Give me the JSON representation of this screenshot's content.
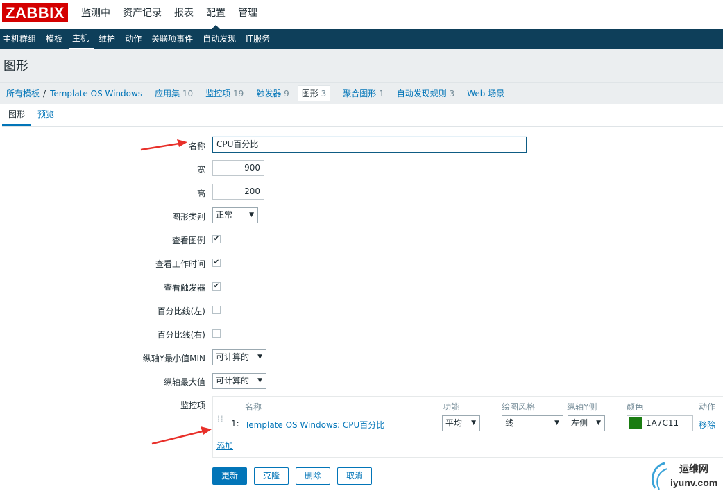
{
  "brand": "ZABBIX",
  "top_menu": [
    "监测中",
    "资产记录",
    "报表",
    "配置",
    "管理"
  ],
  "sub_menu": [
    "主机群组",
    "模板",
    "主机",
    "维护",
    "动作",
    "关联项事件",
    "自动发现",
    "IT服务"
  ],
  "page_title": "图形",
  "breadcrumb": {
    "all_templates": "所有模板",
    "separator": "/",
    "template": "Template OS Windows",
    "apps": {
      "label": "应用集",
      "count": "10"
    },
    "items": {
      "label": "监控项",
      "count": "19"
    },
    "triggers": {
      "label": "触发器",
      "count": "9"
    },
    "graphs": {
      "label": "图形",
      "count": "3"
    },
    "screens": {
      "label": "聚合图形",
      "count": "1"
    },
    "discovery": {
      "label": "自动发现规则",
      "count": "3"
    },
    "web": {
      "label": "Web 场景"
    }
  },
  "tabs": [
    "图形",
    "预览"
  ],
  "form": {
    "name_label": "名称",
    "name_value": "CPU百分比",
    "width_label": "宽",
    "width_value": "900",
    "height_label": "高",
    "height_value": "200",
    "graph_type_label": "图形类别",
    "graph_type_value": "正常",
    "show_legend_label": "查看图例",
    "show_legend": true,
    "show_working_time_label": "查看工作时间",
    "show_working_time": true,
    "show_triggers_label": "查看触发器",
    "show_triggers": true,
    "percentile_left_label": "百分比线(左)",
    "percentile_left": false,
    "percentile_right_label": "百分比线(右)",
    "percentile_right": false,
    "ymin_label": "纵轴Y最小值MIN",
    "ymin_value": "可计算的",
    "ymax_label": "纵轴最大值",
    "ymax_value": "可计算的",
    "items_label": "监控项"
  },
  "items_table": {
    "headers": {
      "name": "名称",
      "function": "功能",
      "draw_style": "绘图风格",
      "y_axis": "纵轴Y侧",
      "color": "颜色",
      "action": "动作"
    },
    "rows": [
      {
        "index": "1:",
        "name": "Template OS Windows: CPU百分比",
        "function": "平均",
        "draw_style": "线",
        "y_axis": "左侧",
        "color": "1A7C11",
        "action": "移除"
      }
    ],
    "add_link": "添加"
  },
  "buttons": {
    "update": "更新",
    "clone": "克隆",
    "delete": "删除",
    "cancel": "取消"
  },
  "watermark": {
    "line1": "运维网",
    "line2": "iyunv.com"
  },
  "colors": {
    "accent": "#0275b8",
    "nav_dark": "#0e3f5a",
    "logo_red": "#d40000",
    "annotation_red": "#e8302a",
    "series_color": "#1A7C11"
  }
}
